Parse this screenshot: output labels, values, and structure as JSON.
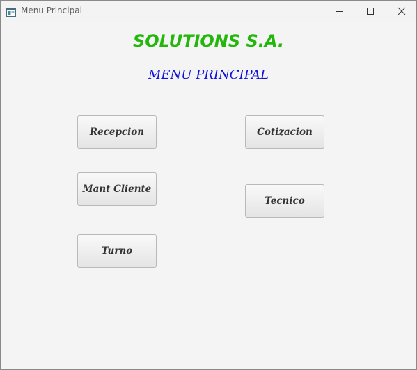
{
  "window": {
    "title": "Menu Principal",
    "icon": "java-window-icon"
  },
  "header": {
    "company": "SOLUTIONS S.A.",
    "subtitle": "MENU PRINCIPAL",
    "company_color": "#23b70b",
    "subtitle_color": "#1010d8"
  },
  "buttons": {
    "recepcion": "Recepcion",
    "mant_cliente": "Mant Cliente",
    "turno": "Turno",
    "cotizacion": "Cotizacion",
    "tecnico": "Tecnico"
  }
}
